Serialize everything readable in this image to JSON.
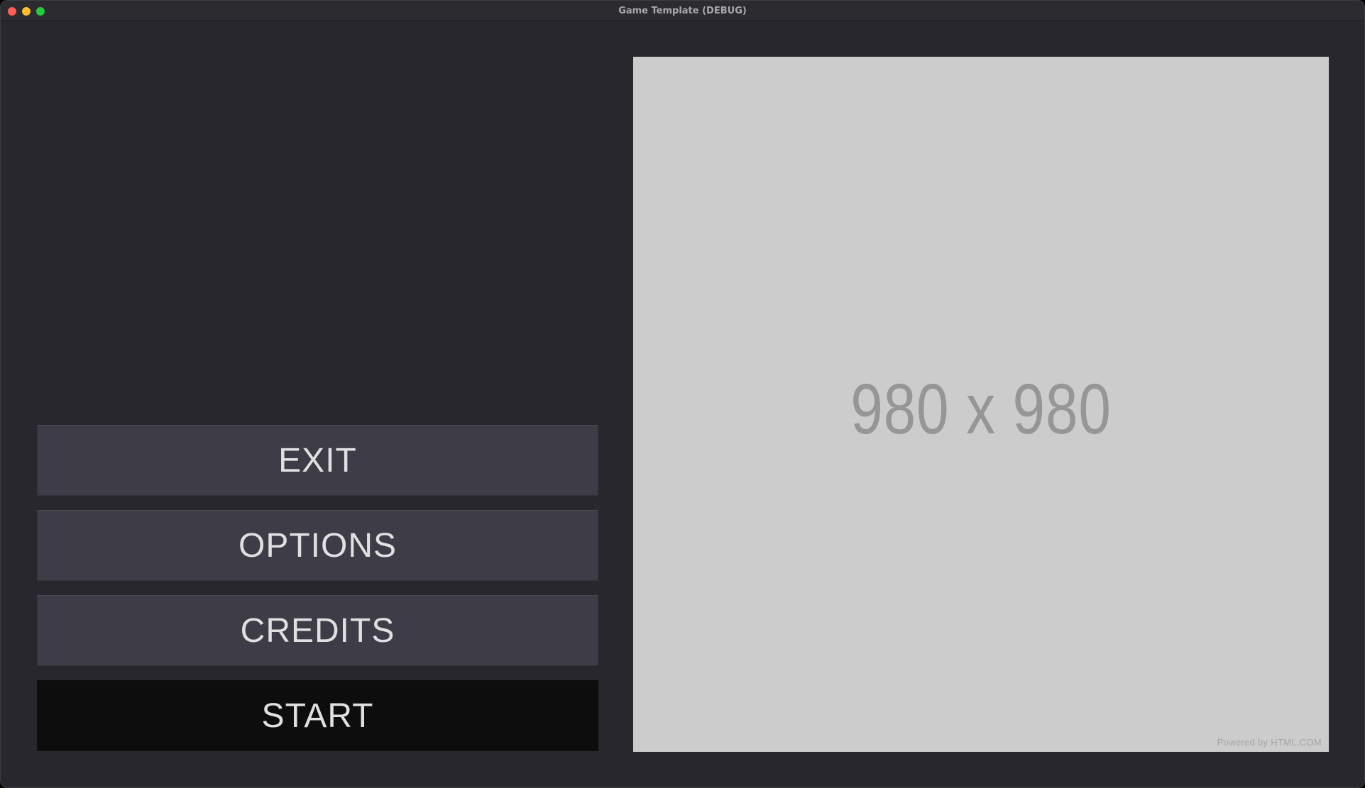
{
  "window": {
    "title": "Game Template (DEBUG)"
  },
  "menu": {
    "buttons": [
      {
        "label": "EXIT"
      },
      {
        "label": "OPTIONS"
      },
      {
        "label": "CREDITS"
      },
      {
        "label": "START",
        "state": "focused"
      }
    ]
  },
  "image_placeholder": {
    "text": "980 x 980",
    "credit": "Powered by HTML.COM"
  },
  "colors": {
    "background": "#27272d",
    "button": "#3d3c47",
    "button_focused": "#0d0d0d",
    "button_text": "#e0e0e0",
    "placeholder_fill": "#cccccc",
    "placeholder_text": "#969696"
  }
}
